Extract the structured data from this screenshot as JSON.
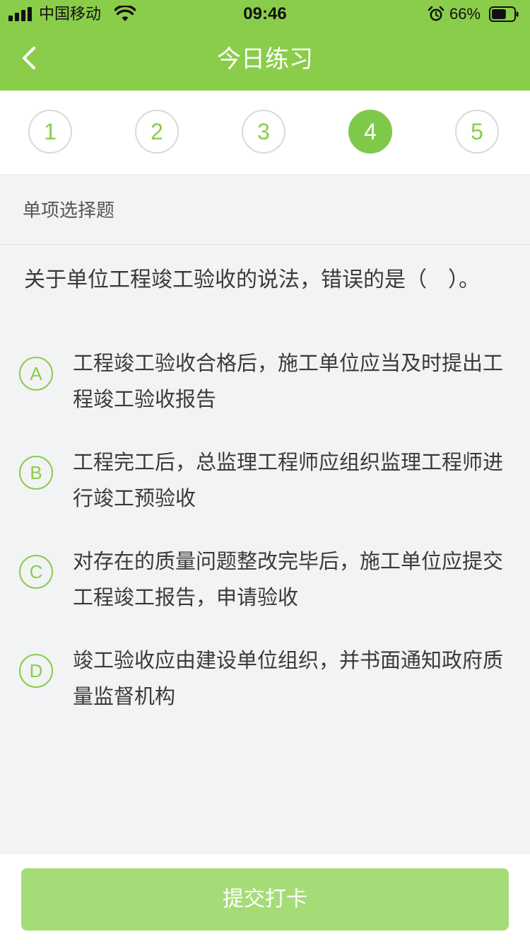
{
  "status_bar": {
    "carrier": "中国移动",
    "time": "09:46",
    "battery": "66%",
    "battery_level": 0.66,
    "icons": [
      "signal-icon",
      "wifi-icon",
      "alarm-icon",
      "battery-icon"
    ]
  },
  "nav": {
    "title": "今日练习",
    "back_icon": "chevron-left-icon"
  },
  "question_numbers": {
    "items": [
      "1",
      "2",
      "3",
      "4",
      "5"
    ],
    "active": "4"
  },
  "question": {
    "type": "单项选择题",
    "text": "关于单位工程竣工验收的说法，错误的是（　）。",
    "options": [
      {
        "key": "A",
        "text": "工程竣工验收合格后，施工单位应当及时提出工程竣工验收报告"
      },
      {
        "key": "B",
        "text": "工程完工后，总监理工程师应组织监理工程师进行竣工预验收"
      },
      {
        "key": "C",
        "text": "对存在的质量问题整改完毕后，施工单位应提交工程竣工报告，申请验收"
      },
      {
        "key": "D",
        "text": "竣工验收应由建设单位组织，并书面通知政府质量监督机构"
      }
    ]
  },
  "submit": {
    "label": "提交打卡"
  },
  "colors": {
    "brand": "#8acd4a",
    "active_number": "#7fc94a",
    "button_disabled": "#a6dc78",
    "background": "#f2f3f5"
  }
}
